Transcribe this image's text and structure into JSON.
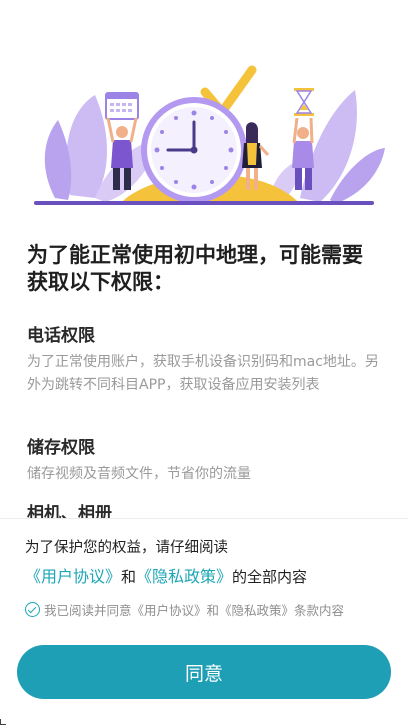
{
  "dialog": {
    "title": "为了能正常使用初中地理，可能需要获取以下权限：",
    "permissions": [
      {
        "title": "电话权限",
        "description": "为了正常使用账户，获取手机设备识别码和mac地址。另外为跳转不同科目APP，获取设备应用安装列表"
      },
      {
        "title": "储存权限",
        "description": "储存视频及音频文件，节省你的流量"
      },
      {
        "title": "相机、相册",
        "description": ""
      }
    ]
  },
  "footer": {
    "notice": "为了保护您的权益，请仔细阅读",
    "user_agreement_link": "《用户协议》",
    "and": "和",
    "privacy_policy_link": "《隐私政策》",
    "suffix": "的全部内容",
    "consent_text": "我已阅读并同意《用户协议》和《隐私政策》条款内容",
    "agree_button": "同意"
  },
  "colors": {
    "accent": "#1f9fb5",
    "link": "#1ea6b7",
    "illustration_purple": "#a88ae8",
    "illustration_yellow": "#f5c33b"
  }
}
